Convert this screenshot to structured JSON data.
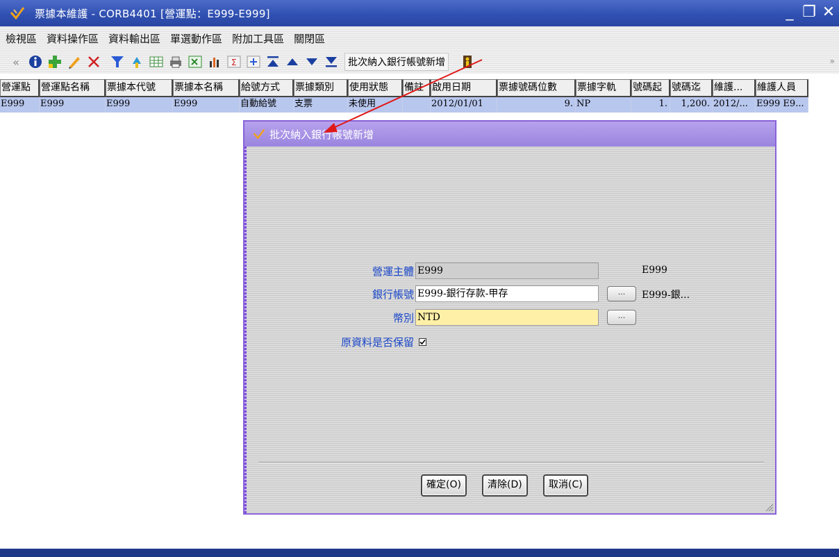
{
  "window": {
    "title": "票據本維護 - CORB4401 [營運點：E999-E999]",
    "min_glyph": "_",
    "restore_glyph": "❐",
    "close_glyph": "✕"
  },
  "menu": {
    "items": [
      "檢視區",
      "資料操作區",
      "資料輸出區",
      "單選動作區",
      "附加工具區",
      "關閉區"
    ]
  },
  "toolbar": {
    "batch_label": "批次納入銀行帳號新增",
    "left_glyph": "«",
    "right_glyph": "»"
  },
  "grid": {
    "columns": [
      "營運點",
      "營運點名稱",
      "票據本代號",
      "票據本名稱",
      "給號方式",
      "票據類別",
      "使用狀態",
      "備註",
      "啟用日期",
      "票據號碼位數",
      "票據字軌",
      "號碼起",
      "號碼迄",
      "維護...",
      "維護人員"
    ],
    "rows": [
      [
        "E999",
        "E999",
        "E999",
        "E999",
        "自動給號",
        "支票",
        "未使用",
        "",
        "2012/01/01",
        "9.",
        "NP",
        "1.",
        "1,200.",
        "2012/...",
        "E999 E9..."
      ]
    ]
  },
  "dialog": {
    "title": "批次納入銀行帳號新增",
    "fields": {
      "entity_label": "營運主體",
      "entity_value": "E999",
      "entity_side": "E999",
      "bank_label": "銀行帳號",
      "bank_value": "E999-銀行存款-甲存",
      "bank_side": "E999-銀...",
      "currency_label": "幣別",
      "currency_value": "NTD",
      "keep_label": "原資料是否保留",
      "keep_checked": true
    },
    "lookup_label": "...",
    "buttons": {
      "ok": "確定(O)",
      "clear": "清除(D)",
      "cancel": "取消(C)"
    }
  },
  "colors": {
    "title_bar": "#2f4fb0",
    "dialog_title": "#9a84df",
    "dialog_border": "#8a62d8",
    "label_blue": "#1a47c8",
    "required_field": "#fff0a8",
    "disabled_field": "#cfcfcf",
    "selected_row": "#b8c7ee",
    "annotation_arrow": "#e01818"
  }
}
